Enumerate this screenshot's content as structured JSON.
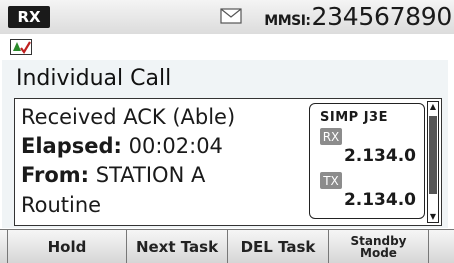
{
  "status_bar": {
    "mode_badge": "RX",
    "mail_icon": "envelope-icon",
    "mmsi_label": "MMSI:",
    "mmsi_value": "234567890"
  },
  "icon_bar": {
    "dsc_icon": "dsc-status-icon"
  },
  "screen": {
    "title": "Individual Call",
    "lines": [
      {
        "label": "",
        "value": "Received ACK (Able)"
      },
      {
        "label": "Elapsed:",
        "value": " 00:02:04"
      },
      {
        "label": "From:",
        "value": " STATION A"
      },
      {
        "label": "",
        "value": "Routine"
      }
    ],
    "frequency_box": {
      "mode": "SIMP J3E",
      "rx_tag": "RX",
      "rx_freq": "2.134.0",
      "tx_tag": "TX",
      "tx_freq": "2.134.0"
    }
  },
  "softkeys": [
    {
      "label": "Hold"
    },
    {
      "label": "Next Task"
    },
    {
      "label": "DEL Task"
    },
    {
      "label": "Standby\nMode"
    }
  ],
  "colors": {
    "badge_bg": "#1a1a1a",
    "panel_bg": "#f0f4f6",
    "tag_bg": "#8c8c8c"
  }
}
